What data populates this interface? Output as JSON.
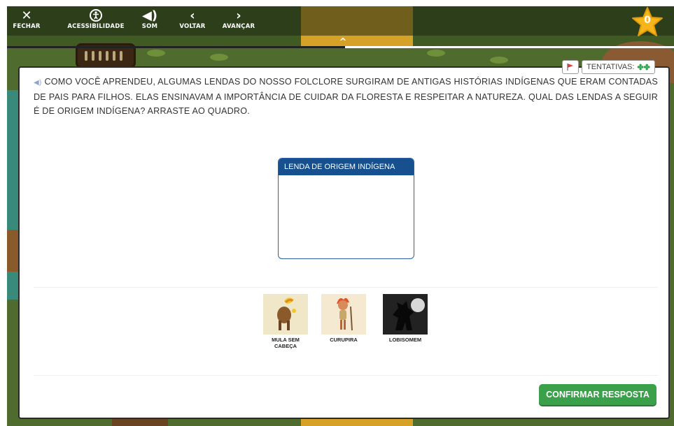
{
  "toolbar": {
    "items": [
      {
        "label": "FECHAR",
        "icon": "close-icon"
      },
      {
        "label": "ACESSIBILIDADE",
        "icon": "accessibility-icon"
      },
      {
        "label": "SOM",
        "icon": "speaker-icon"
      },
      {
        "label": "VOLTAR",
        "icon": "chevron-left-icon"
      },
      {
        "label": "AVANÇAR",
        "icon": "chevron-right-icon"
      }
    ]
  },
  "score": {
    "value": "0",
    "icon": "star-icon",
    "color": "#f6b619"
  },
  "attempts": {
    "label": "TENTATIVAS:",
    "icon": "clover-icon",
    "flag_icon": "flag-icon"
  },
  "question": {
    "text": "COMO VOCÊ APRENDEU, ALGUMAS LENDAS DO NOSSO FOLCLORE SURGIRAM DE ANTIGAS HISTÓRIAS INDÍGENAS QUE ERAM CONTADAS DE PAIS PARA FILHOS. ELAS ENSINAVAM A IMPORTÂNCIA DE CUIDAR DA FLORESTA E RESPEITAR A NATUREZA. QUAL DAS LENDAS A SEGUIR É DE ORIGEM INDÍGENA? ARRASTE AO QUADRO.",
    "speaker_icon": "speaker-icon"
  },
  "dropzone": {
    "title": "LENDA DE ORIGEM INDÍGENA"
  },
  "options": [
    {
      "caption": "MULA SEM CABEÇA",
      "caption_line1": "MULA SEM",
      "caption_line2": "CABEÇA"
    },
    {
      "caption": "CURUPIRA"
    },
    {
      "caption": "LOBISOMEM"
    }
  ],
  "confirm": {
    "label": "CONFIRMAR RESPOSTA"
  },
  "colors": {
    "accent_green": "#3aa04a",
    "header_blue": "#16508f"
  }
}
